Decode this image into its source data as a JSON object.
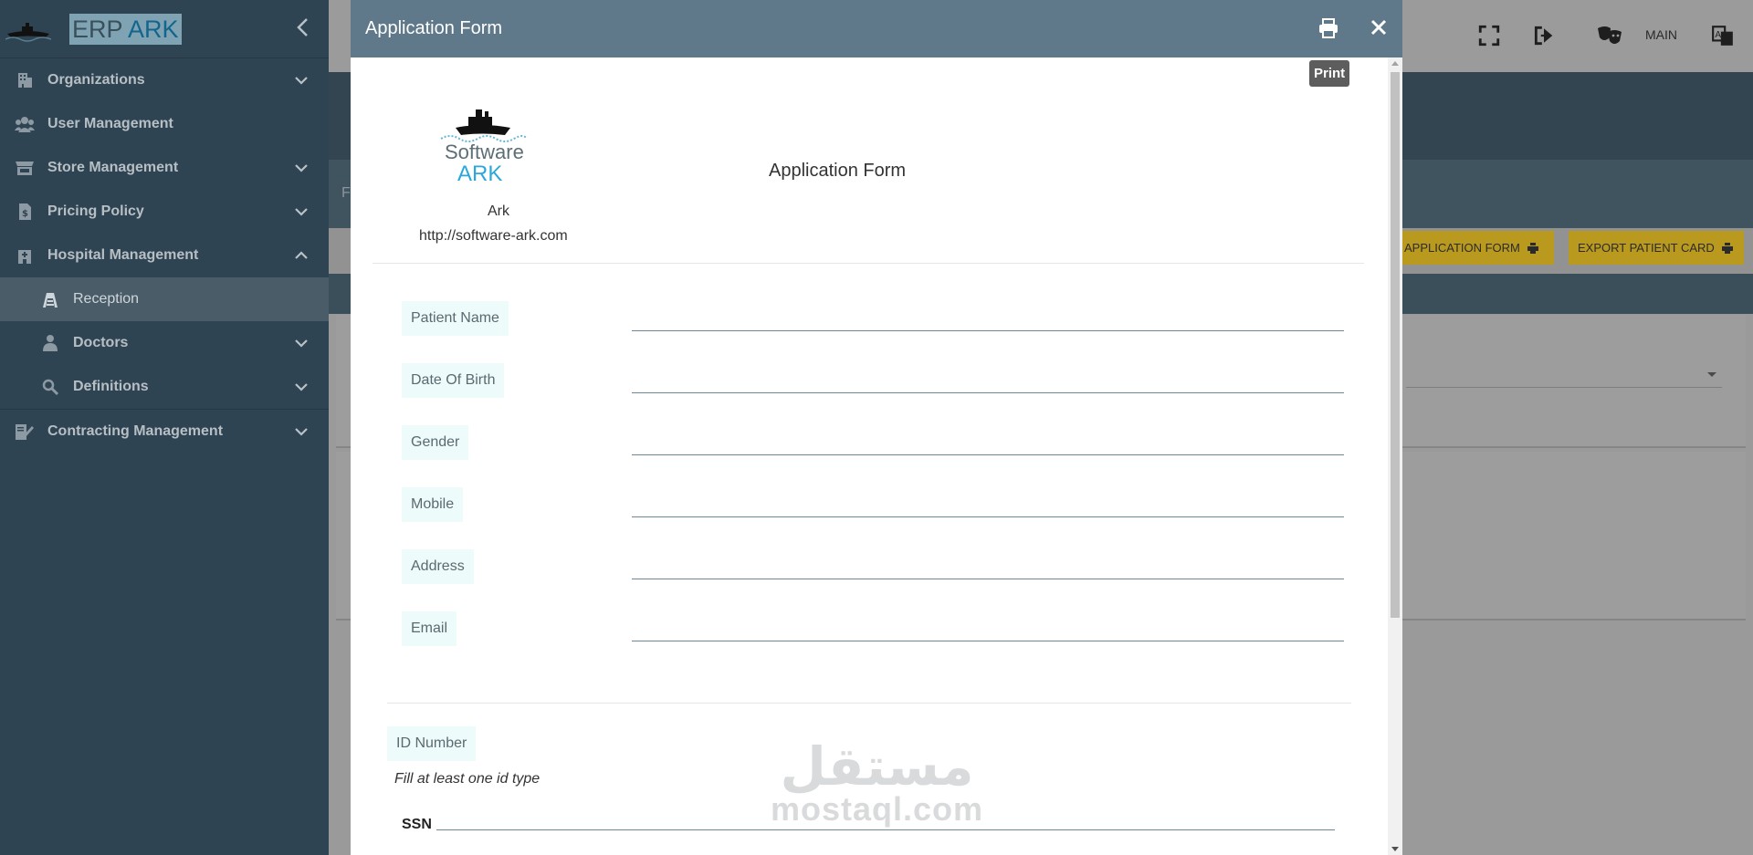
{
  "sidebar": {
    "brand": {
      "part1": "ERP ",
      "part2": "ARK"
    },
    "items": [
      {
        "label": "Organizations"
      },
      {
        "label": "User Management"
      },
      {
        "label": "Store Management"
      },
      {
        "label": "Pricing Policy"
      },
      {
        "label": "Hospital Management"
      },
      {
        "label": "Reception"
      },
      {
        "label": "Doctors"
      },
      {
        "label": "Definitions"
      },
      {
        "label": "Contracting Management"
      }
    ]
  },
  "topbar": {
    "main_label": "MAIN"
  },
  "background": {
    "band_initial": "F",
    "buttons": [
      {
        "label": "APPLICATION FORM"
      },
      {
        "label": "EXPORT PATIENT CARD"
      }
    ]
  },
  "modal": {
    "title": "Application Form",
    "print_tooltip": "Print",
    "org": {
      "name": "Ark",
      "url": "http://software-ark.com",
      "logo_text1": "Software",
      "logo_text2": "ARK"
    },
    "doc_title": "Application Form",
    "fields": [
      {
        "label": "Patient Name"
      },
      {
        "label": "Date Of Birth"
      },
      {
        "label": "Gender"
      },
      {
        "label": "Mobile"
      },
      {
        "label": "Address"
      },
      {
        "label": "Email"
      }
    ],
    "id_section": {
      "label": "ID Number",
      "note": "Fill at least one id type",
      "ssn_label": "SSN"
    }
  },
  "watermark": {
    "arabic": "مستقل",
    "latin": "mostaql.com"
  },
  "colors": {
    "sidebar": "#2f4452",
    "modal_header": "#60798a",
    "field_label_bg": "#eefbfb",
    "button": "#b99a1f"
  }
}
